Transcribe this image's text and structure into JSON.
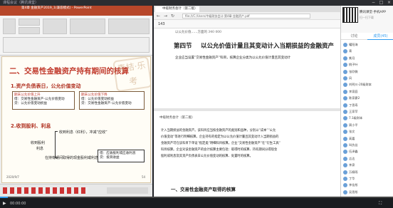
{
  "window": {
    "title": "课程会议（腾讯课堂）"
  },
  "ppt": {
    "title": "第4章 金融资产2019_1(兼容模式) - PowerPoint",
    "slide": {
      "heading": "二、交易性金融资产持有期间的核算",
      "stamp": "青桔·乐考",
      "sub1": "1.资产负债表日，公允价值变动",
      "box1_line1": "期末公允价值上升",
      "box1_line2": "借：交易性金融资产-公允价值变动",
      "box1_line3": "贷：公允价值变动损益",
      "box2_line1": "期末公允价值下降",
      "box2_line2": "借：公允价值变动损益",
      "box2_line3": "贷：交易性金融资产-公允价值变动",
      "sub2": "2.收到股利、利息",
      "row1": "收到利息（红利），冲减“应收”",
      "row2a": "收到股利",
      "row2b": "利息",
      "row3": "在持有期间取得的现金股利或利息",
      "box3_line1": "借：应收股利或应收利息",
      "box3_line2": "贷：投资收益",
      "foot_left": "2020/9/7",
      "foot_right": "54"
    }
  },
  "browser": {
    "tab_label": "中级财务会计（第二版）",
    "url": "file:///C:/Users/中级财务会计-第4章-金融资产.pdf",
    "page_indicator": "143",
    "pdf": {
      "top_line": "以公允价值……方面的   340 000",
      "section_no": "第四节",
      "section_title": "以公允价值计量且其变动计入当期损益的金融资产",
      "p1": "企业应当设置“交易性金融资产”科目，核算企业分类为以公允价值计量且其变动计",
      "header2": "中级财务会计（第二版）",
      "p2_l1": "计入当期损益的金融资产。该科目应当按金融资产的类别和品种，分别以“成本”“公允",
      "p2_l2": "价值变动”等进行明细核算。企业持有的指定为以公允价值计量且其变动计入当期损益的",
      "p2_l3": "金融资产可在该科目下单设“指定类”明细科目核算。企业“交易性金融资产”在“衍生工具”",
      "p2_l4": "科目核算。企业对该金融资产的会计核算主要包括：取得时的核算、持有期间分得现金",
      "p2_l5": "股利或利息及其资产负债表日公允价值变动的核算、处置时的核算。",
      "sub_heading": "一、交易性金融资产取得的核算"
    }
  },
  "right_panel": {
    "app_title": "腾讯课堂·手机APP",
    "app_sub": "扫一扫下载",
    "tab_discuss": "讨论",
    "tab_members": "成员(45)",
    "members": [
      "耀阳海",
      "青",
      "紫月",
      "桃子叶",
      "张欣微",
      "风",
      "刘明川-20级财本",
      "李家庭",
      "陈家豪2",
      "丁思寿",
      "王家苹",
      "7.1级财本",
      "周小平",
      "张文",
      "高嘉",
      "叫仇佳",
      "伍泽鑫",
      "吉达",
      "李泉",
      "万柳雨",
      "丁华",
      "李佳彤",
      "吴思彤"
    ]
  },
  "player": {
    "time": "00:00:00",
    "progress": 0.02
  }
}
